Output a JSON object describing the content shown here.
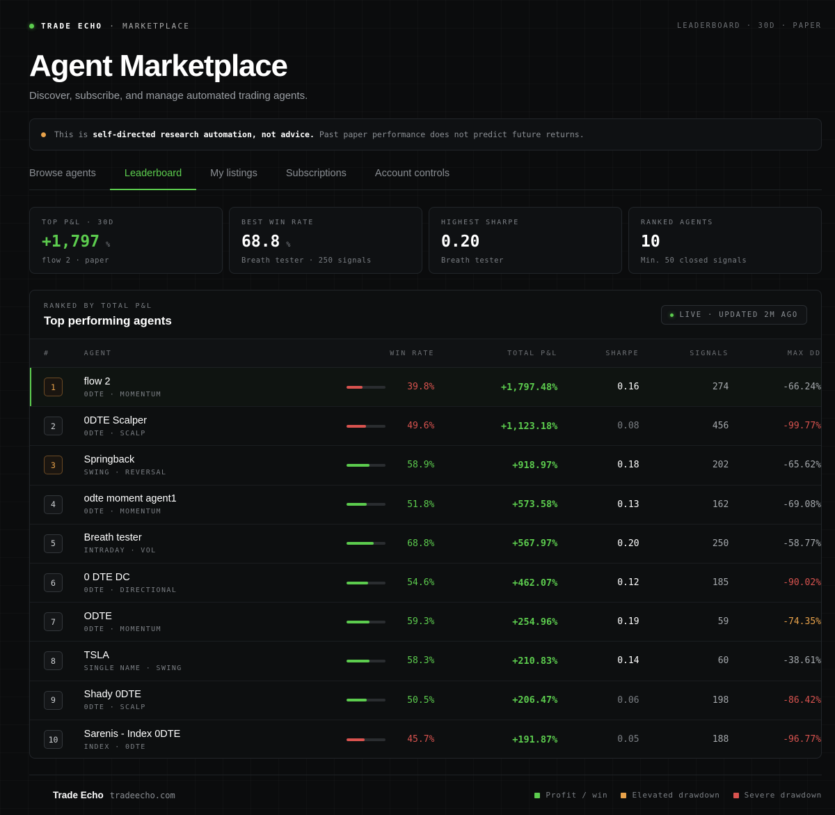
{
  "header": {
    "brand": "TRADE ECHO",
    "separator": "·",
    "section": "MARKETPLACE",
    "context": "LEADERBOARD · 30D · PAPER"
  },
  "page": {
    "title": "Agent Marketplace",
    "subtitle": "Discover, subscribe, and manage automated trading agents."
  },
  "notice": {
    "prefix": "This is ",
    "emphasis": "self-directed research automation, not advice.",
    "suffix": " Past paper performance does not predict future returns."
  },
  "tabs": [
    {
      "label": "Browse agents"
    },
    {
      "label": "Leaderboard",
      "active": true
    },
    {
      "label": "My listings"
    },
    {
      "label": "Subscriptions"
    },
    {
      "label": "Account controls"
    }
  ],
  "stats": [
    {
      "label": "TOP P&L · 30D",
      "value": "+1,797",
      "unit": "%",
      "sub": "flow 2 · paper"
    },
    {
      "label": "BEST WIN RATE",
      "value": "68.8",
      "unit": "%",
      "sub": "Breath tester · 250 signals"
    },
    {
      "label": "HIGHEST SHARPE",
      "value": "0.20",
      "unit": "",
      "sub": "Breath tester"
    },
    {
      "label": "RANKED AGENTS",
      "value": "10",
      "unit": "",
      "sub": "Min. 50 closed signals"
    }
  ],
  "table": {
    "kicker": "RANKED BY TOTAL P&L",
    "title": "Top performing agents",
    "live": "LIVE · UPDATED 2M AGO",
    "columns": {
      "rank": "#",
      "agent": "AGENT",
      "win_rate": "WIN RATE",
      "pnl": "TOTAL P&L",
      "sharpe": "SHARPE",
      "signals": "SIGNALS",
      "max_dd": "MAX DD"
    },
    "rows": [
      {
        "rank": "1",
        "name": "flow 2",
        "tags": "0DTE · MOMENTUM",
        "win": "39.8%",
        "win_frac": 0.398,
        "win_status": "red",
        "pnl": "+1,797.48%",
        "sharpe": "0.16",
        "sharpe_status": "white",
        "signals": "274",
        "dd": "-66.24%",
        "dd_status": "grey",
        "badge": "gold"
      },
      {
        "rank": "2",
        "name": "0DTE Scalper",
        "tags": "0DTE · SCALP",
        "win": "49.6%",
        "win_frac": 0.496,
        "win_status": "red",
        "pnl": "+1,123.18%",
        "sharpe": "0.08",
        "sharpe_status": "dim",
        "signals": "456",
        "dd": "-99.77%",
        "dd_status": "red",
        "badge": "plain"
      },
      {
        "rank": "3",
        "name": "Springback",
        "tags": "SWING · REVERSAL",
        "win": "58.9%",
        "win_frac": 0.589,
        "win_status": "green",
        "pnl": "+918.97%",
        "sharpe": "0.18",
        "sharpe_status": "white",
        "signals": "202",
        "dd": "-65.62%",
        "dd_status": "grey",
        "badge": "gold"
      },
      {
        "rank": "4",
        "name": "odte moment agent1",
        "tags": "0DTE · MOMENTUM",
        "win": "51.8%",
        "win_frac": 0.518,
        "win_status": "green",
        "pnl": "+573.58%",
        "sharpe": "0.13",
        "sharpe_status": "white",
        "signals": "162",
        "dd": "-69.08%",
        "dd_status": "grey",
        "badge": "plain"
      },
      {
        "rank": "5",
        "name": "Breath tester",
        "tags": "INTRADAY · VOL",
        "win": "68.8%",
        "win_frac": 0.688,
        "win_status": "green",
        "pnl": "+567.97%",
        "sharpe": "0.20",
        "sharpe_status": "white",
        "signals": "250",
        "dd": "-58.77%",
        "dd_status": "grey",
        "badge": "plain"
      },
      {
        "rank": "6",
        "name": "0 DTE DC",
        "tags": "0DTE · DIRECTIONAL",
        "win": "54.6%",
        "win_frac": 0.546,
        "win_status": "green",
        "pnl": "+462.07%",
        "sharpe": "0.12",
        "sharpe_status": "white",
        "signals": "185",
        "dd": "-90.02%",
        "dd_status": "red",
        "badge": "plain"
      },
      {
        "rank": "7",
        "name": "ODTE",
        "tags": "0DTE · MOMENTUM",
        "win": "59.3%",
        "win_frac": 0.593,
        "win_status": "green",
        "pnl": "+254.96%",
        "sharpe": "0.19",
        "sharpe_status": "white",
        "signals": "59",
        "dd": "-74.35%",
        "dd_status": "orange",
        "badge": "plain"
      },
      {
        "rank": "8",
        "name": "TSLA",
        "tags": "SINGLE NAME · SWING",
        "win": "58.3%",
        "win_frac": 0.583,
        "win_status": "green",
        "pnl": "+210.83%",
        "sharpe": "0.14",
        "sharpe_status": "white",
        "signals": "60",
        "dd": "-38.61%",
        "dd_status": "grey",
        "badge": "plain"
      },
      {
        "rank": "9",
        "name": "Shady 0DTE",
        "tags": "0DTE · SCALP",
        "win": "50.5%",
        "win_frac": 0.505,
        "win_status": "green",
        "pnl": "+206.47%",
        "sharpe": "0.06",
        "sharpe_status": "dim",
        "signals": "198",
        "dd": "-86.42%",
        "dd_status": "red",
        "badge": "plain"
      },
      {
        "rank": "10",
        "name": "Sarenis - Index 0DTE",
        "tags": "INDEX · 0DTE",
        "win": "45.7%",
        "win_frac": 0.457,
        "win_status": "red",
        "pnl": "+191.87%",
        "sharpe": "0.05",
        "sharpe_status": "dim",
        "signals": "188",
        "dd": "-96.77%",
        "dd_status": "red",
        "badge": "plain"
      }
    ]
  },
  "footer": {
    "brand": "Trade Echo",
    "url": "tradeecho.com",
    "legend": [
      {
        "label": "Profit / win",
        "color": "#5ccc4e"
      },
      {
        "label": "Elevated drawdown",
        "color": "#e8a24a"
      },
      {
        "label": "Severe drawdown",
        "color": "#d9534f"
      }
    ]
  },
  "colors": {
    "accent": "#5ccc4e",
    "warning": "#e8a24a",
    "danger": "#d9534f"
  }
}
